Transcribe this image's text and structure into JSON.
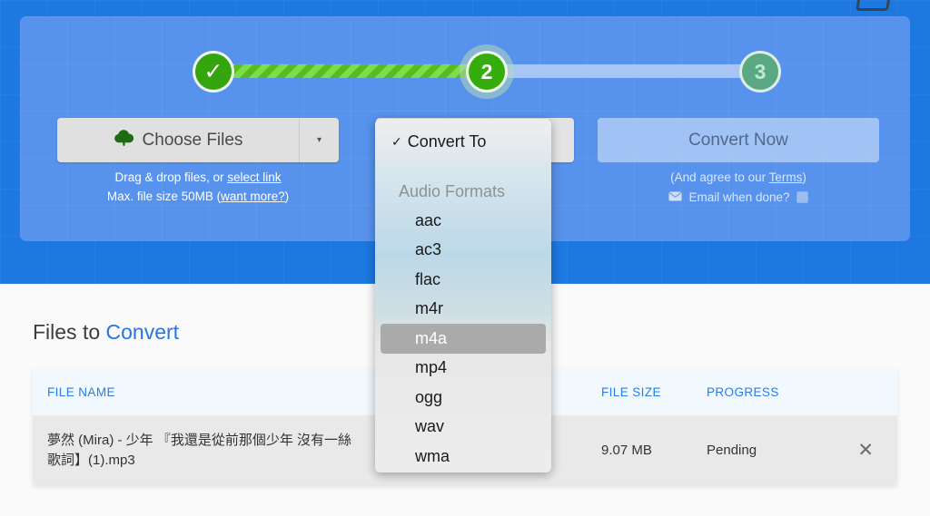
{
  "stepper": {
    "step1_glyph": "✓",
    "step2_label": "2",
    "step3_label": "3"
  },
  "uploader": {
    "choose_files_label": "Choose Files",
    "choose_icon": "cloud-upload-icon",
    "dropdown_arrow": "▾",
    "hint_prefix": "Drag & drop files, or ",
    "hint_link": "select link",
    "maxsize_prefix": "Max. file size 50MB (",
    "maxsize_link": "want more?",
    "maxsize_suffix": ")"
  },
  "convert": {
    "button_label": "Convert Now",
    "terms_prefix": "(And agree to our ",
    "terms_link": "Terms",
    "terms_suffix": ")",
    "email_label": "Email when done?",
    "email_icon": "envelope-icon",
    "email_checked": false
  },
  "menu": {
    "selected_label": "Convert To",
    "check_glyph": "✓",
    "group_label": "Audio Formats",
    "highlighted": "m4a",
    "options": [
      "aac",
      "ac3",
      "flac",
      "m4r",
      "m4a",
      "mp4",
      "ogg",
      "wav",
      "wma"
    ]
  },
  "files_section": {
    "title_plain": "Files to ",
    "title_accent": "Convert",
    "columns": {
      "name": "FILE NAME",
      "size": "FILE SIZE",
      "progress": "PROGRESS"
    },
    "rows": [
      {
        "name_line1": "夢然 (Mira) - 少年 『我還是從前那個少年 沒有一絲",
        "name_line2": "歌詞】(1).mp3",
        "size": "9.07 MB",
        "progress": "Pending",
        "remove_glyph": "✕"
      }
    ]
  },
  "colors": {
    "band_blue": "#1d78e0",
    "panel_blue": "#5792ec",
    "accent_blue": "#2476e8",
    "step_green": "#35ad0c",
    "highlight_gray": "#aaaaaa"
  }
}
